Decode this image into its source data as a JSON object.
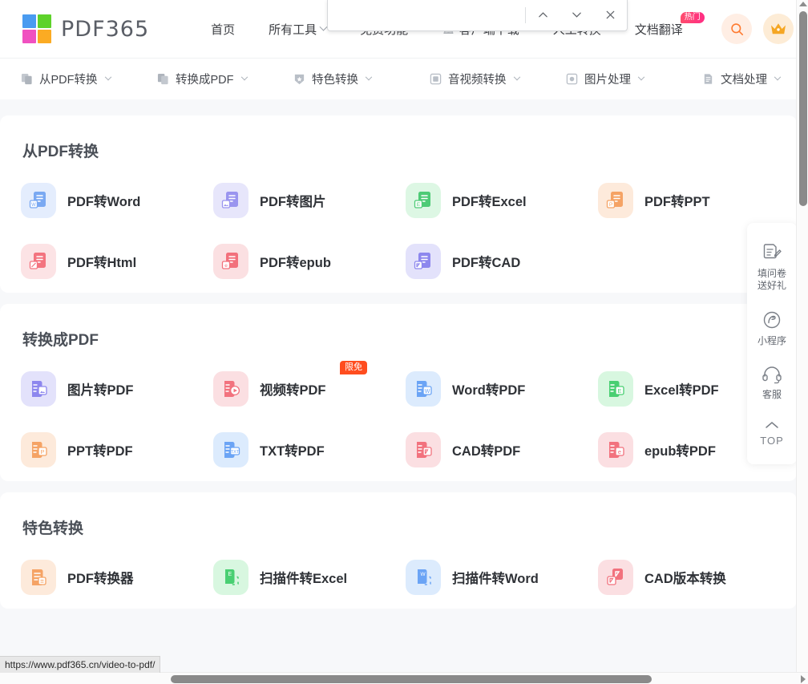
{
  "header": {
    "brand": "PDF365",
    "nav": [
      {
        "label": "首页",
        "has_caret": false,
        "obscured": false
      },
      {
        "label": "所有工具",
        "has_caret": true,
        "obscured": false
      },
      {
        "label": "免费功能",
        "has_caret": false,
        "obscured": true
      },
      {
        "label": "客户端下载",
        "has_caret": false,
        "obscured": true
      },
      {
        "label": "人工转换",
        "has_caret": false,
        "obscured": true
      },
      {
        "label": "文档翻译",
        "has_caret": false,
        "obscured": false,
        "badge": "热门"
      }
    ],
    "search_icon": "search-icon",
    "vip_icon": "crown-icon"
  },
  "subnav": [
    {
      "label": "从PDF转换",
      "icon": "pdf-export-icon"
    },
    {
      "label": "转换成PDF",
      "icon": "pdf-import-icon"
    },
    {
      "label": "特色转换",
      "icon": "star-shield-icon"
    },
    {
      "label": "音视频转换",
      "icon": "media-icon"
    },
    {
      "label": "图片处理",
      "icon": "image-icon"
    },
    {
      "label": "文档处理",
      "icon": "document-icon"
    }
  ],
  "findbar": {
    "value": "",
    "placeholder": "",
    "prev_label": "上一个",
    "next_label": "下一个",
    "close_label": "关闭"
  },
  "sections": [
    {
      "title": "从PDF转换",
      "tools": [
        {
          "label": "PDF转Word",
          "icon": "pdf-to-word-icon",
          "bg": "#e4edfd",
          "fg": "#7aa9f2",
          "tag": "W"
        },
        {
          "label": "PDF转图片",
          "icon": "pdf-to-image-icon",
          "bg": "#e7e6fb",
          "fg": "#9a95ef",
          "tag": "I"
        },
        {
          "label": "PDF转Excel",
          "icon": "pdf-to-excel-icon",
          "bg": "#ddf7e4",
          "fg": "#4ecb76",
          "tag": "E"
        },
        {
          "label": "PDF转PPT",
          "icon": "pdf-to-ppt-icon",
          "bg": "#fdeadb",
          "fg": "#f5a365",
          "tag": "P"
        },
        {
          "label": "PDF转Html",
          "icon": "pdf-to-html-icon",
          "bg": "#fce3e5",
          "fg": "#f3747f",
          "tag": "H"
        },
        {
          "label": "PDF转epub",
          "icon": "pdf-to-epub-icon",
          "bg": "#fbe0e2",
          "fg": "#f2717c",
          "tag": "e"
        },
        {
          "label": "PDF转CAD",
          "icon": "pdf-to-cad-icon",
          "bg": "#e3e2fb",
          "fg": "#8d87ee",
          "tag": "A"
        }
      ]
    },
    {
      "title": "转换成PDF",
      "tools": [
        {
          "label": "图片转PDF",
          "icon": "image-to-pdf-icon",
          "bg": "#e3e2fb",
          "fg": "#8d87ee",
          "tag": "I"
        },
        {
          "label": "视频转PDF",
          "icon": "video-to-pdf-icon",
          "bg": "#fbdfe2",
          "fg": "#f2727e",
          "tag": "V",
          "badge": "限免"
        },
        {
          "label": "Word转PDF",
          "icon": "word-to-pdf-icon",
          "bg": "#dcebfd",
          "fg": "#6ba4f5",
          "tag": "W"
        },
        {
          "label": "Excel转PDF",
          "icon": "excel-to-pdf-icon",
          "bg": "#d8f7e0",
          "fg": "#49cf72",
          "tag": "E"
        },
        {
          "label": "PPT转PDF",
          "icon": "ppt-to-pdf-icon",
          "bg": "#fdeadb",
          "fg": "#f5a365",
          "tag": "P"
        },
        {
          "label": "TXT转PDF",
          "icon": "txt-to-pdf-icon",
          "bg": "#dcebfd",
          "fg": "#6ba4f5",
          "tag": "T"
        },
        {
          "label": "CAD转PDF",
          "icon": "cad-to-pdf-icon",
          "bg": "#fbdfe2",
          "fg": "#f2727e",
          "tag": "A"
        },
        {
          "label": "epub转PDF",
          "icon": "epub-to-pdf-icon",
          "bg": "#fbdfe2",
          "fg": "#f2727e",
          "tag": "e"
        }
      ]
    },
    {
      "title": "特色转换",
      "tools": [
        {
          "label": "PDF转换器",
          "icon": "pdf-converter-icon",
          "bg": "#fdeadb",
          "fg": "#f5a365",
          "tag": "C"
        },
        {
          "label": "扫描件转Excel",
          "icon": "scan-to-excel-icon",
          "bg": "#d8f7e0",
          "fg": "#49cf72",
          "tag": "E"
        },
        {
          "label": "扫描件转Word",
          "icon": "scan-to-word-icon",
          "bg": "#dcebfd",
          "fg": "#6ba4f5",
          "tag": "W"
        },
        {
          "label": "CAD版本转换",
          "icon": "cad-version-icon",
          "bg": "#fbdfe2",
          "fg": "#f2727e",
          "tag": "A"
        }
      ]
    }
  ],
  "rail": [
    {
      "label": "填问卷\n送好礼",
      "icon": "survey-icon"
    },
    {
      "label": "小程序",
      "icon": "miniprogram-icon"
    },
    {
      "label": "客服",
      "icon": "headset-icon"
    },
    {
      "label": "TOP",
      "icon": "chevron-up-icon"
    }
  ],
  "statusbar": {
    "url": "https://www.pdf365.cn/video-to-pdf/"
  },
  "colors": {
    "page_bg": "#f7f8fa",
    "panel_bg": "#ffffff",
    "accent_orange": "#ff7a2f",
    "badge_hot": "#ff2d84",
    "badge_free": "#ff4d1f",
    "text_primary": "#2f3237",
    "text_secondary": "#6b7079"
  }
}
